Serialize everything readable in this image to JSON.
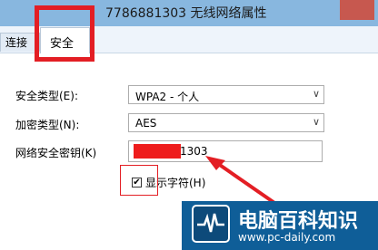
{
  "window": {
    "title": "7786881303 无线网络属性"
  },
  "tabs": {
    "connect": "连接",
    "security": "安全"
  },
  "form": {
    "security_type_label": "安全类型(E):",
    "security_type_value": "WPA2 - 个人",
    "encryption_type_label": "加密类型(N):",
    "encryption_type_value": "AES",
    "network_key_label": "网络安全密钥(K)",
    "network_key_visible_tail": "1303",
    "show_chars_label": "显示字符(H)",
    "show_chars_checked": true
  },
  "watermark": {
    "title": "电脑百科知识",
    "url": "www.pc-daily.com"
  },
  "colors": {
    "annotation_red": "#e31e24",
    "title_bar": "#88b7df",
    "watermark_bg": "#0f5e98"
  }
}
